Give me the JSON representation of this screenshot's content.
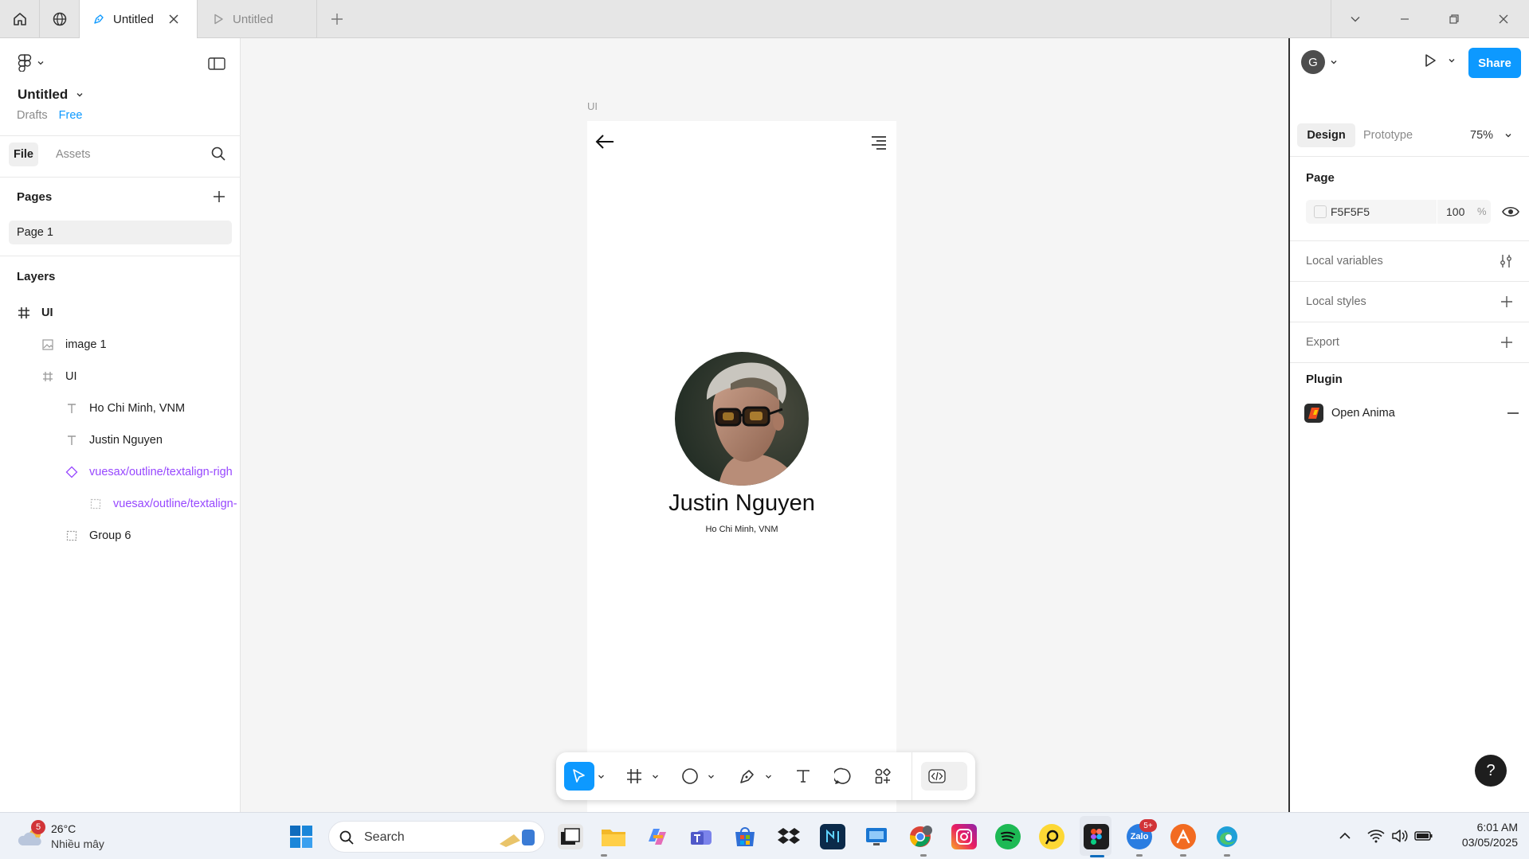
{
  "tabs": [
    {
      "label": "Untitled",
      "active": true
    },
    {
      "label": "Untitled",
      "active": false
    }
  ],
  "file": {
    "title": "Untitled",
    "location": "Drafts",
    "plan": "Free"
  },
  "left_tabs": {
    "file": "File",
    "assets": "Assets"
  },
  "pages": {
    "heading": "Pages",
    "items": [
      "Page 1"
    ]
  },
  "layers": {
    "heading": "Layers",
    "items": [
      {
        "label": "UI",
        "icon": "frame-icon"
      },
      {
        "label": "image 1",
        "icon": "image-icon"
      },
      {
        "label": "UI",
        "icon": "frame-icon"
      },
      {
        "label": "Ho Chi Minh, VNM",
        "icon": "text-icon"
      },
      {
        "label": "Justin Nguyen",
        "icon": "text-icon"
      },
      {
        "label": "vuesax/outline/textalign-righ",
        "icon": "component-icon"
      },
      {
        "label": "vuesax/outline/textalign-",
        "icon": "group-icon"
      },
      {
        "label": "Group 6",
        "icon": "group-icon"
      }
    ]
  },
  "canvas": {
    "frame_label": "UI",
    "profile": {
      "name": "Justin Nguyen",
      "location": "Ho Chi Minh, VNM"
    }
  },
  "right": {
    "avatar_letter": "G",
    "share_label": "Share",
    "tabs": {
      "design": "Design",
      "prototype": "Prototype"
    },
    "zoom": "75%",
    "page_heading": "Page",
    "page_color": "F5F5F5",
    "page_opacity": "100",
    "percent": "%",
    "local_variables": "Local variables",
    "local_styles": "Local styles",
    "export": "Export",
    "plugin_heading": "Plugin",
    "plugin_name": "Open Anima",
    "help": "?"
  },
  "taskbar": {
    "weather_badge": "5",
    "temperature": "26°C",
    "weather_desc": "Nhiều mây",
    "search_placeholder": "Search",
    "zalo_badge": "5+",
    "time": "6:01 AM",
    "date": "03/05/2025"
  },
  "colors": {
    "accent": "#0d99ff",
    "component_purple": "#9747ff",
    "page_bg": "#F5F5F5"
  }
}
